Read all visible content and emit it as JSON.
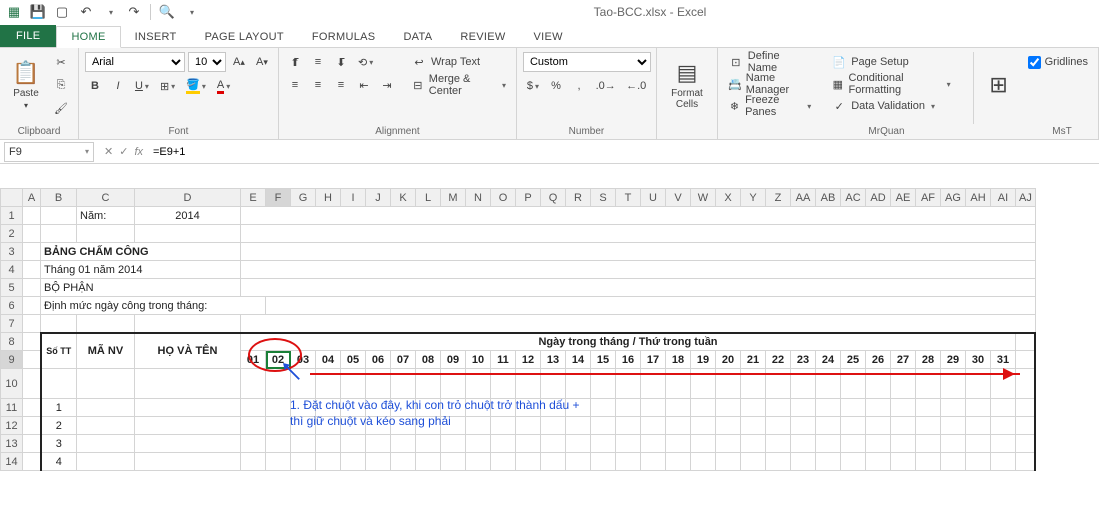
{
  "title": "Tao-BCC.xlsx - Excel",
  "tabs": {
    "file": "FILE",
    "home": "HOME",
    "insert": "INSERT",
    "pagelayout": "PAGE LAYOUT",
    "formulas": "FORMULAS",
    "data": "DATA",
    "review": "REVIEW",
    "view": "VIEW"
  },
  "ribbon": {
    "clipboard": {
      "paste": "Paste",
      "label": "Clipboard"
    },
    "font": {
      "name": "Arial",
      "size": "10",
      "label": "Font"
    },
    "alignment": {
      "wrap": "Wrap Text",
      "merge": "Merge & Center",
      "label": "Alignment"
    },
    "number": {
      "format": "Custom",
      "label": "Number"
    },
    "cells": {
      "format": "Format Cells",
      "label": ""
    },
    "mrquan": {
      "define": "Define Name",
      "nmgr": "Name Manager",
      "freeze": "Freeze Panes",
      "pagesetup": "Page Setup",
      "condfmt": "Conditional Formatting",
      "datavalid": "Data Validation",
      "gridlines": "Gridlines",
      "label": "MrQuan",
      "label2": "MsT"
    }
  },
  "formula_bar": {
    "cell": "F9",
    "formula": "=E9+1"
  },
  "sheet": {
    "cols": [
      "A",
      "B",
      "C",
      "D",
      "E",
      "F",
      "G",
      "H",
      "I",
      "J",
      "K",
      "L",
      "M",
      "N",
      "O",
      "P",
      "Q",
      "R",
      "S",
      "T",
      "U",
      "V",
      "W",
      "X",
      "Y",
      "Z",
      "AA",
      "AB",
      "AC",
      "AD",
      "AE",
      "AF",
      "AG",
      "AH",
      "AI",
      "AJ"
    ],
    "row1_label": "Năm:",
    "row1_year": "2014",
    "row3_title": "BẢNG CHẤM CÔNG",
    "row4": "Tháng 01 năm 2014",
    "row5": "BỘ PHẬN",
    "row6": "Định mức ngày công trong tháng:",
    "row8_header": "Ngày trong tháng / Thứ trong tuần",
    "row9_stt": "Số TT",
    "row9_manv": "MÃ NV",
    "row9_hoten": "HỌ VÀ TÊN",
    "days": [
      "01",
      "02",
      "03",
      "04",
      "05",
      "06",
      "07",
      "08",
      "09",
      "10",
      "11",
      "12",
      "13",
      "14",
      "15",
      "16",
      "17",
      "18",
      "19",
      "20",
      "21",
      "22",
      "23",
      "24",
      "25",
      "26",
      "27",
      "28",
      "29",
      "30",
      "31"
    ],
    "rownums": [
      "1",
      "2",
      "3",
      "4"
    ]
  },
  "annotation": {
    "line1": "1. Đặt chuột vào đây, khi con trỏ chuột trở thành dấu +",
    "line2": "thì giữ chuột và kéo sang phải"
  }
}
